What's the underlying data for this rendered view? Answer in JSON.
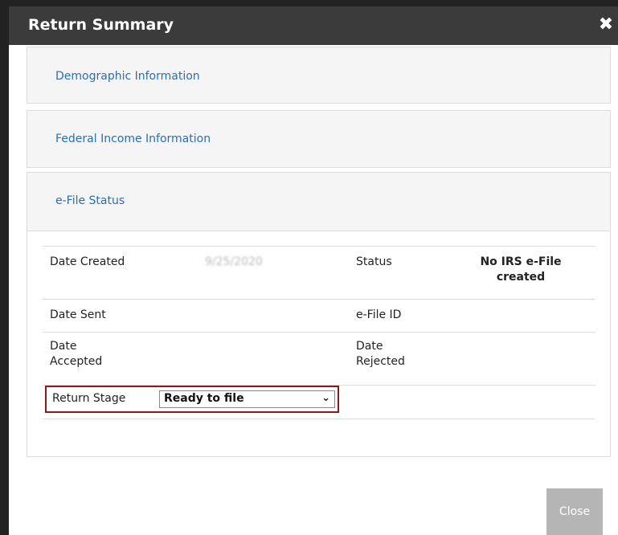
{
  "dialog": {
    "title": "Return Summary",
    "close_glyph": "✖"
  },
  "sections": {
    "demographic": "Demographic Information",
    "federal": "Federal Income Information",
    "efile": "e-File Status"
  },
  "efile_status": {
    "date_created_label": "Date Created",
    "date_created_value": "9/25/2020",
    "status_label": "Status",
    "status_value": "No IRS e-File created",
    "date_sent_label": "Date Sent",
    "efile_id_label": "e-File ID",
    "date_accepted_label": "Date Accepted",
    "date_rejected_label": "Date Rejected",
    "return_stage_label": "Return Stage",
    "return_stage_value": "Ready to file"
  },
  "footer": {
    "close_label": "Close"
  }
}
